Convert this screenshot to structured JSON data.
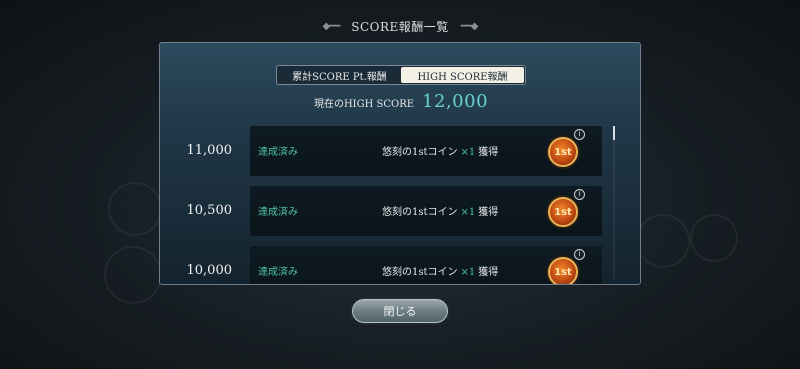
{
  "header": {
    "title": "SCORE報酬一覧",
    "left_ornament": "◆━━",
    "right_ornament": "━━◆"
  },
  "tabs": [
    {
      "label": "累計SCORE Pt.報酬",
      "active": false
    },
    {
      "label": "HIGH SCORE報酬",
      "active": true
    }
  ],
  "current": {
    "label": "現在のHIGH SCORE",
    "value": "12,000"
  },
  "rewards": [
    {
      "score": "11,000",
      "status": "達成済み",
      "item": "悠刻の1stコイン",
      "mult": "×1",
      "suffix": "獲得",
      "icon": "coin-1st-icon",
      "coin_text": "1st",
      "info": "i"
    },
    {
      "score": "10,500",
      "status": "達成済み",
      "item": "悠刻の1stコイン",
      "mult": "×1",
      "suffix": "獲得",
      "icon": "coin-1st-icon",
      "coin_text": "1st",
      "info": "i"
    },
    {
      "score": "10,000",
      "status": "達成済み",
      "item": "悠刻の1stコイン",
      "mult": "×1",
      "suffix": "獲得",
      "icon": "coin-1st-icon",
      "coin_text": "1st",
      "info": "i"
    }
  ],
  "close_button": "閉じる",
  "colors": {
    "accent": "#6ad0cf",
    "achieved": "#4fc2a6",
    "panel": "#1f3646"
  }
}
